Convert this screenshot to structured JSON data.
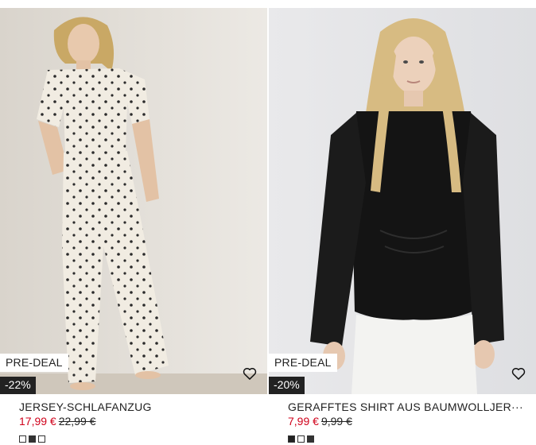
{
  "products": [
    {
      "badge": "PRE-DEAL",
      "discount": "-22%",
      "name": "JERSEY-SCHLAFANZUG",
      "price_now": "17,99 €",
      "price_was": "22,99 €",
      "swatches": [
        "#ffffff",
        "#333333",
        "#ffffff"
      ],
      "favorite_icon": "heart-outline-icon",
      "image": "model-cream-dotted-pajama-set"
    },
    {
      "badge": "PRE-DEAL",
      "discount": "-20%",
      "name": "GERAFFTES SHIRT AUS BAUMWOLLJER···",
      "price_now": "7,99 €",
      "price_was": "9,99 €",
      "swatches": [
        "#222222",
        "#ffffff",
        "#333333"
      ],
      "favorite_icon": "heart-outline-icon",
      "image": "model-black-gathered-longsleeve-shirt"
    }
  ],
  "colors": {
    "sale_price": "#d0021b",
    "text": "#222222",
    "discount_badge_bg": "#222222"
  }
}
